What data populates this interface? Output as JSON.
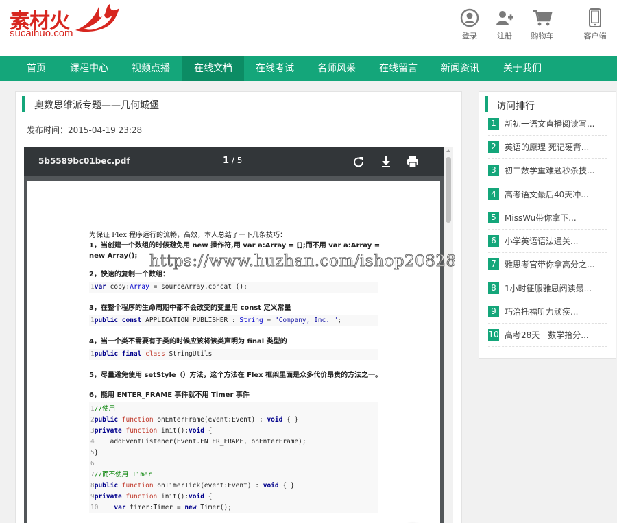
{
  "header": {
    "logo_main": "素材火",
    "logo_sub": "sucaihuo.com",
    "nav": [
      {
        "icon": "user-circle-icon",
        "label": "登录"
      },
      {
        "icon": "user-plus-icon",
        "label": "注册"
      },
      {
        "icon": "cart-icon",
        "label": "购物车"
      },
      {
        "icon": "phone-icon",
        "label": "客户端"
      }
    ]
  },
  "navbar": {
    "items": [
      "首页",
      "课程中心",
      "视频点播",
      "在线文档",
      "在线考试",
      "名师风采",
      "在线留言",
      "新闻资讯",
      "关于我们"
    ],
    "active_index": 3
  },
  "article": {
    "title": "奥数思维派专题——几何城堡",
    "publish": "发布时间：2015-04-19 23:28"
  },
  "pdf": {
    "filename": "5b5589bc01bec.pdf",
    "current_page": "1",
    "page_sep": " / ",
    "total_pages": "5",
    "tools": [
      "rotate-icon",
      "download-icon",
      "print-icon"
    ],
    "content": {
      "intro": "为保证 Flex 程序运行的流畅，高效，本人总结了一下几条技巧：",
      "tip1": "1，当创建一个数组的时候避免用 new 操作符,用 var a:Array = [];而不用 var a:Array = new Array();",
      "tip2": "2，快速的复制一个数组：",
      "code2": "var copy:Array = sourceArray.concat ();",
      "tip3": "3，在整个程序的生命周期中都不会改变的变量用 const 定义常量",
      "code3": "public const APPLICATION_PUBLISHER : String = \"Company, Inc. \";",
      "tip4": "4，当一个类不需要有子类的时候应该将该类声明为 final 类型的",
      "code4": "public final class StringUtils",
      "tip5": "5，尽量避免使用 setStyle（）方法，这个方法在 Flex 框架里面是众多代价昂贵的方法之一。",
      "tip6": "6，能用 ENTER_FRAME 事件就不用 Timer 事件",
      "code6": [
        "//使用",
        "public function onEnterFrame(event:Event) : void { }",
        "private function init():void {",
        "    addEventListener(Event.ENTER_FRAME, onEnterFrame);",
        "}",
        "",
        "//而不使用 Timer",
        "public function onTimerTick(event:Event) : void { }",
        "private function init():void {",
        "    var timer:Timer = new Timer();"
      ]
    }
  },
  "watermark": "https://www.huzhan.com/ishop20828",
  "sidebar": {
    "title": "访问排行",
    "items": [
      {
        "num": "1",
        "text": "新初一语文直播阅读写..."
      },
      {
        "num": "2",
        "text": "英语的原理 死记硬背..."
      },
      {
        "num": "3",
        "text": "初二数学重难题秒杀技..."
      },
      {
        "num": "4",
        "text": "高考语文最后40天冲..."
      },
      {
        "num": "5",
        "text": "MissWu带你拿下..."
      },
      {
        "num": "6",
        "text": "小学英语语法通关..."
      },
      {
        "num": "7",
        "text": "雅思考官带你拿高分之..."
      },
      {
        "num": "8",
        "text": "1小时征服雅思阅读最..."
      },
      {
        "num": "9",
        "text": "巧治托福听力顽疾..."
      },
      {
        "num": "10",
        "text": "高考28天一数学拾分..."
      }
    ]
  },
  "colors": {
    "brand_red": "#d7261f",
    "nav_green": "#14a67a",
    "nav_active": "#0c8c64"
  }
}
